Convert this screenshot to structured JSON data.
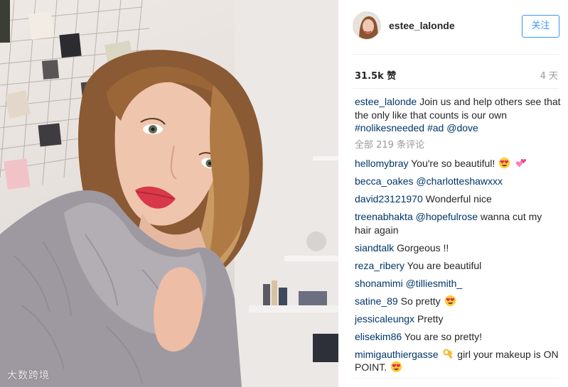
{
  "post": {
    "username": "estee_lalonde",
    "follow_label": "关注",
    "likes": "31.5k 赞",
    "time": "4 天",
    "caption": {
      "user": "estee_lalonde",
      "text": "Join us and help others see that the only like that counts is our own",
      "tags": [
        "#nolikesneeded",
        "#ad",
        "@dove"
      ]
    },
    "all_comments": "全部 219 条评论"
  },
  "comments": [
    {
      "user": "hellomybray",
      "text": "You're so beautiful!",
      "emoji": [
        "heart-eyes-emoji",
        "pink-hearts-emoji"
      ]
    },
    {
      "user": "becca_oakes",
      "mention": "@charlotteshawxxx",
      "text": ""
    },
    {
      "user": "david23121970",
      "text": "Wonderful nice"
    },
    {
      "user": "treenabhakta",
      "mention": "@hopefulrose",
      "text": "wanna cut my hair again"
    },
    {
      "user": "siandtalk",
      "text": "Gorgeous !!"
    },
    {
      "user": "reza_ribery",
      "text": "You are beautiful"
    },
    {
      "user": "shonamimi",
      "mention": "@tilliesmith_",
      "text": ""
    },
    {
      "user": "satine_89",
      "text": "So pretty",
      "emoji": [
        "heart-eyes-emoji"
      ]
    },
    {
      "user": "jessicaleungx",
      "text": "Pretty"
    },
    {
      "user": "elisekim86",
      "text": "You are so pretty!"
    },
    {
      "user": "mimigauthiergasse",
      "text_before": "",
      "emoji": [
        "ok-hand-emoji",
        "heart-eyes-emoji"
      ],
      "text": "girl your makeup is ON POINT."
    }
  ],
  "watermark": "大数跨境",
  "colors": {
    "link": "#003569",
    "follow": "#3897f0",
    "muted": "#999999"
  }
}
